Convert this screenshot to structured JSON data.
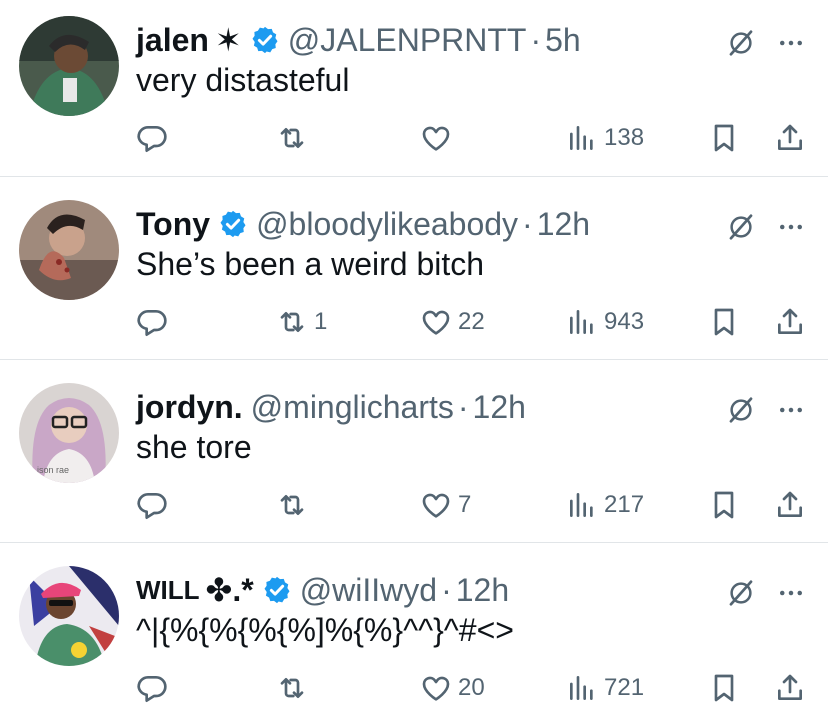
{
  "colors": {
    "verified": "#1d9bf0",
    "muted": "#536471",
    "text": "#0f1419"
  },
  "tweets": [
    {
      "name": "jalen",
      "name_symbol": "✶",
      "verified": true,
      "handle": "@JALENPRNTT",
      "dot": "·",
      "time": "5h",
      "text": "very distasteful",
      "reply_count": "",
      "retweet_count": "",
      "like_count": "",
      "view_count": "138"
    },
    {
      "name": "Tony",
      "name_symbol": "",
      "verified": true,
      "handle": "@bloodylikeabody",
      "dot": "·",
      "time": "12h",
      "text": "She’s been a weird bitch",
      "reply_count": "",
      "retweet_count": "1",
      "like_count": "22",
      "view_count": "943"
    },
    {
      "name": "jordyn.",
      "name_symbol": "",
      "verified": false,
      "handle": "@minglicharts",
      "dot": "·",
      "time": "12h",
      "text": "she tore",
      "avatar_shirt_text": "ison rae",
      "reply_count": "",
      "retweet_count": "",
      "like_count": "7",
      "view_count": "217"
    },
    {
      "name": "WILL",
      "name_symbol": "✤.*",
      "verified": true,
      "handle": "@wiIIwyd",
      "dot": "·",
      "time": "12h",
      "text": "^|{%{%{%{%]%{%}^^}^#<>",
      "reply_count": "",
      "retweet_count": "",
      "like_count": "20",
      "view_count": "721"
    }
  ]
}
